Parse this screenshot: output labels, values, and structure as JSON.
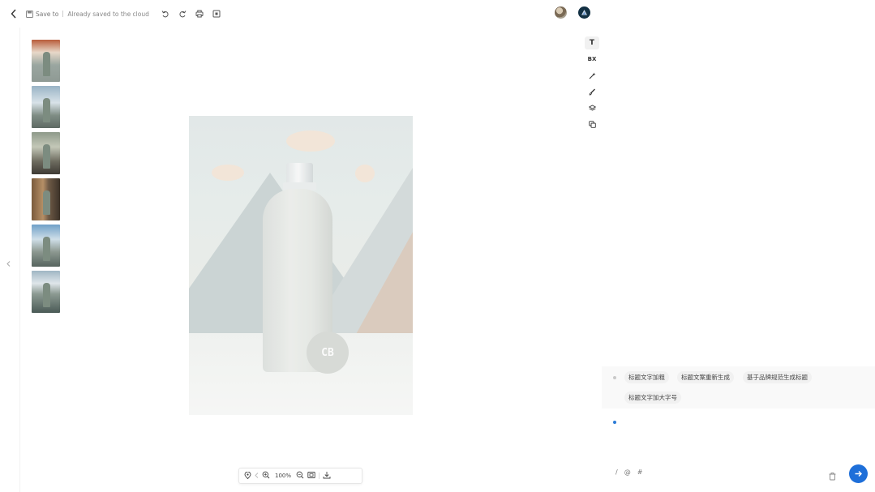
{
  "toolbar": {
    "save_label": "Save to",
    "status_text": "Already saved to the cloud"
  },
  "zoom": {
    "value": "100%"
  },
  "canvas": {
    "badge_text": "CB"
  },
  "tools": [
    {
      "label": "T",
      "icon": "text-icon"
    },
    {
      "label": "BX",
      "icon": "bx-icon"
    },
    {
      "label": "",
      "icon": "magic-wand-icon"
    },
    {
      "label": "",
      "icon": "brush-icon"
    },
    {
      "label": "",
      "icon": "layers-icon"
    },
    {
      "label": "",
      "icon": "duplicate-icon"
    }
  ],
  "chat": {
    "suggestions": [
      "标题文字加粗",
      "标题文案重新生成",
      "基于品牌规范生成标题",
      "标题文字加大字号"
    ],
    "composer": {
      "slash": "/",
      "at": "@",
      "hash": "#"
    }
  },
  "colors": {
    "accent": "#1e6fd9",
    "canvas_bg": "#ffffff"
  }
}
